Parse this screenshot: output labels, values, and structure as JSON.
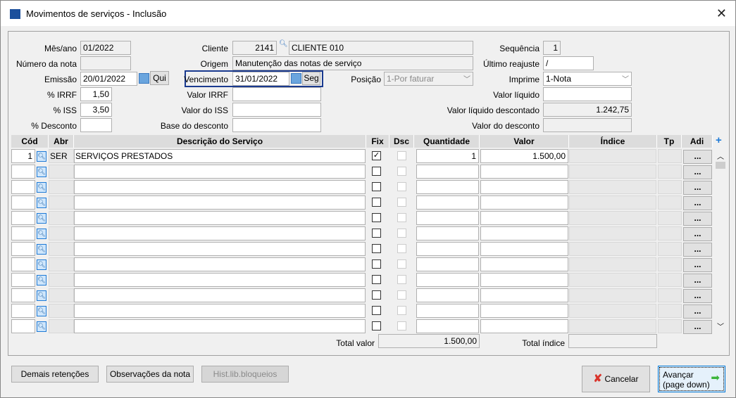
{
  "window": {
    "title": "Movimentos de serviços - Inclusão",
    "close": "✕"
  },
  "form": {
    "mes_ano": {
      "label": "Mês/ano",
      "value": "01/2022"
    },
    "numero_nota": {
      "label": "Número da nota",
      "value": ""
    },
    "emissao": {
      "label": "Emissão",
      "value": "20/01/2022",
      "weekday": "Qui"
    },
    "irrf": {
      "label": "% IRRF",
      "value": "1,50"
    },
    "iss": {
      "label": "% ISS",
      "value": "3,50"
    },
    "desconto": {
      "label": "% Desconto",
      "value": ""
    },
    "cliente": {
      "label": "Cliente",
      "code": "2141",
      "name": "CLIENTE 010"
    },
    "origem": {
      "label": "Origem",
      "value": "Manutenção das notas de serviço"
    },
    "vencimento": {
      "label": "Vencimento",
      "value": "31/01/2022",
      "weekday": "Seg"
    },
    "valor_irrf": {
      "label": "Valor IRRF",
      "value": ""
    },
    "valor_iss": {
      "label": "Valor do ISS",
      "value": ""
    },
    "base_desconto": {
      "label": "Base do desconto",
      "value": ""
    },
    "posicao": {
      "label": "Posição",
      "value": "1-Por faturar"
    },
    "sequencia": {
      "label": "Sequência",
      "value": "1"
    },
    "ultimo_reajuste": {
      "label": "Último reajuste",
      "value": "/"
    },
    "imprime": {
      "label": "Imprime",
      "value": "1-Nota"
    },
    "valor_liquido": {
      "label": "Valor líquido",
      "value": ""
    },
    "valor_liquido_desc": {
      "label": "Valor líquido descontado",
      "value": "1.242,75"
    },
    "valor_desconto": {
      "label": "Valor do desconto",
      "value": ""
    }
  },
  "grid": {
    "headers": {
      "cod": "Cód",
      "abr": "Abr",
      "desc": "Descrição do Serviço",
      "fix": "Fix",
      "dsc": "Dsc",
      "qtd": "Quantidade",
      "valor": "Valor",
      "indice": "Índice",
      "tp": "Tp",
      "adi": "Adi"
    },
    "rows": [
      {
        "cod": "1",
        "abr": "SER",
        "desc": "SERVIÇOS PRESTADOS",
        "fix": true,
        "qtd": "1",
        "valor": "1.500,00"
      },
      {},
      {},
      {},
      {},
      {},
      {},
      {},
      {},
      {},
      {},
      {}
    ],
    "adi_label": "...",
    "total_valor": {
      "label": "Total valor",
      "value": "1.500,00"
    },
    "total_indice": {
      "label": "Total índice",
      "value": ""
    }
  },
  "buttons": {
    "demais": "Demais retenções",
    "observacoes": "Observações da nota",
    "hist": "Hist.lib.bloqueios",
    "cancelar": "Cancelar",
    "avancar": "Avançar",
    "avancar_sub": "(page down)"
  }
}
